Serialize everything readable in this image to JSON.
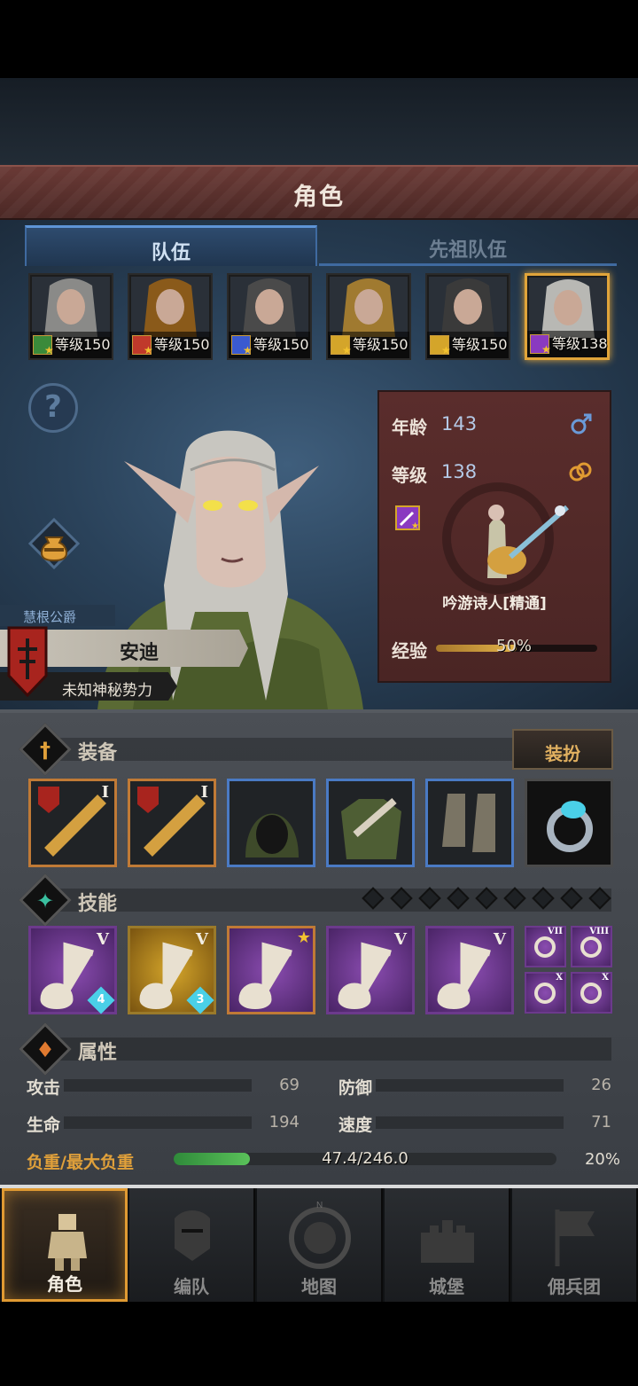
{
  "header": {
    "title": "角色"
  },
  "tabs": [
    {
      "label": "队伍",
      "active": true
    },
    {
      "label": "先祖队伍",
      "active": false
    }
  ],
  "party": [
    {
      "level_text": "等级150",
      "class_color": "#3a8a3a",
      "hair": "#8a8a88",
      "selected": false
    },
    {
      "level_text": "等级150",
      "class_color": "#c0392b",
      "hair": "#8a5a1a",
      "selected": false
    },
    {
      "level_text": "等级150",
      "class_color": "#3a5ad0",
      "hair": "#4a4a4a",
      "selected": false
    },
    {
      "level_text": "等级150",
      "class_color": "#d4a52a",
      "hair": "#a07a30",
      "selected": false
    },
    {
      "level_text": "等级150",
      "class_color": "#d4a52a",
      "hair": "#3a3a3a",
      "selected": false
    },
    {
      "level_text": "等级138",
      "class_color": "#8a3ac0",
      "hair": "#b8b8b4",
      "selected": true
    }
  ],
  "hero": {
    "title": "慧根公爵",
    "name": "安迪",
    "faction": "未知神秘势力"
  },
  "info": {
    "age_label": "年龄",
    "age_value": "143",
    "level_label": "等级",
    "level_value": "138",
    "class_name": "吟游诗人[精通]",
    "exp_label": "经验",
    "exp_percent_text": "50%",
    "exp_fraction": 0.5
  },
  "equipment": {
    "section_title": "装备",
    "dress_button": "装扮",
    "slots": [
      {
        "name": "lute-weapon-slot",
        "rarity": "orange",
        "roman": "I"
      },
      {
        "name": "lute-weapon-slot-2",
        "rarity": "orange",
        "roman": "I"
      },
      {
        "name": "hood-slot",
        "rarity": "blue",
        "roman": ""
      },
      {
        "name": "tunic-slot",
        "rarity": "blue",
        "roman": ""
      },
      {
        "name": "boots-slot",
        "rarity": "blue",
        "roman": ""
      },
      {
        "name": "ring-slot",
        "rarity": "gray",
        "roman": ""
      }
    ]
  },
  "skills": {
    "section_title": "技能",
    "pips": 9,
    "slots": [
      {
        "name": "song-skill",
        "style": "purple",
        "roman": "V",
        "count": "4"
      },
      {
        "name": "holy-shield-skill",
        "style": "gold",
        "roman": "V",
        "count": "3"
      },
      {
        "name": "crystal-song-skill",
        "style": "purple",
        "roman": "",
        "count": ""
      },
      {
        "name": "crystal-hand-skill",
        "style": "purple",
        "roman": "V",
        "count": ""
      },
      {
        "name": "crystal-group-skill",
        "style": "purple",
        "roman": "V",
        "count": ""
      }
    ],
    "passives": [
      {
        "name": "compass-passive",
        "roman": "VII"
      },
      {
        "name": "wand-passive",
        "roman": "VIII"
      },
      {
        "name": "burst-passive",
        "roman": "X"
      },
      {
        "name": "shield-passive",
        "roman": "X"
      }
    ]
  },
  "attributes": {
    "section_title": "属性",
    "attack_label": "攻击",
    "attack_value": "69",
    "defense_label": "防御",
    "defense_value": "26",
    "hp_label": "生命",
    "hp_value": "194",
    "speed_label": "速度",
    "speed_value": "71",
    "load_label": "负重/最大负重",
    "load_text": "47.4/246.0",
    "load_percent_text": "20%",
    "load_fraction": 0.2
  },
  "nav": [
    {
      "label": "角色",
      "active": true
    },
    {
      "label": "编队",
      "active": false
    },
    {
      "label": "地图",
      "active": false
    },
    {
      "label": "城堡",
      "active": false
    },
    {
      "label": "佣兵团",
      "active": false
    }
  ],
  "nav_compass_letter": "N",
  "colors": {
    "accent_gold": "#e09a32",
    "tab_blue": "#3f6aa0",
    "title_bar": "#5a302d"
  }
}
